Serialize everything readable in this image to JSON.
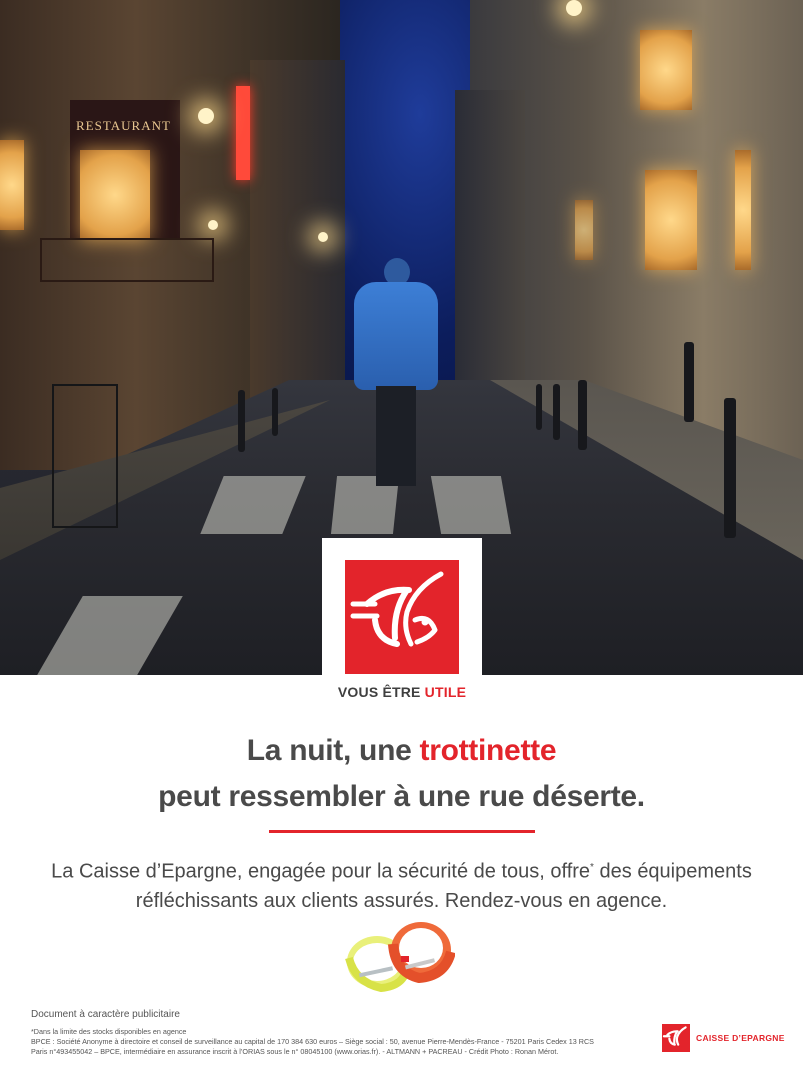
{
  "photo": {
    "restaurant_sign": "RESTAURANT"
  },
  "logo": {
    "tagline_prefix": "VOUS ÊTRE ",
    "tagline_accent": "UTILE",
    "brand_color": "#e3242b"
  },
  "headline": {
    "line1_prefix": "La nuit, une ",
    "line1_accent": "trottinette",
    "line2": "peut ressembler à une rue déserte."
  },
  "body": {
    "line1_part1": "La Caisse d’Epargne, engagée pour la sécurité de tous, offre",
    "line1_sup": "*",
    "line1_part2": " des équipements",
    "line2": "réfléchissants aux clients assurés. Rendez-vous en agence."
  },
  "footer": {
    "document_note": "Document à caractère publicitaire",
    "legal_line1": "*Dans la limite des stocks disponibles en agence",
    "legal_line2": "BPCE : Société Anonyme à directoire et conseil de surveillance au capital de 170 384 630 euros  – Siège social : 50, avenue Pierre-Mendès-France - 75201 Paris Cedex 13 RCS",
    "legal_line3": "Paris n°493455042 – BPCE, intermédiaire en assurance inscrit à l’ORIAS sous le n° 08045100 (www.orias.fr). - ALTMANN + PACREAU - Crédit Photo : Ronan Mérot.",
    "brand_name": "CAISSE D’EPARGNE"
  }
}
